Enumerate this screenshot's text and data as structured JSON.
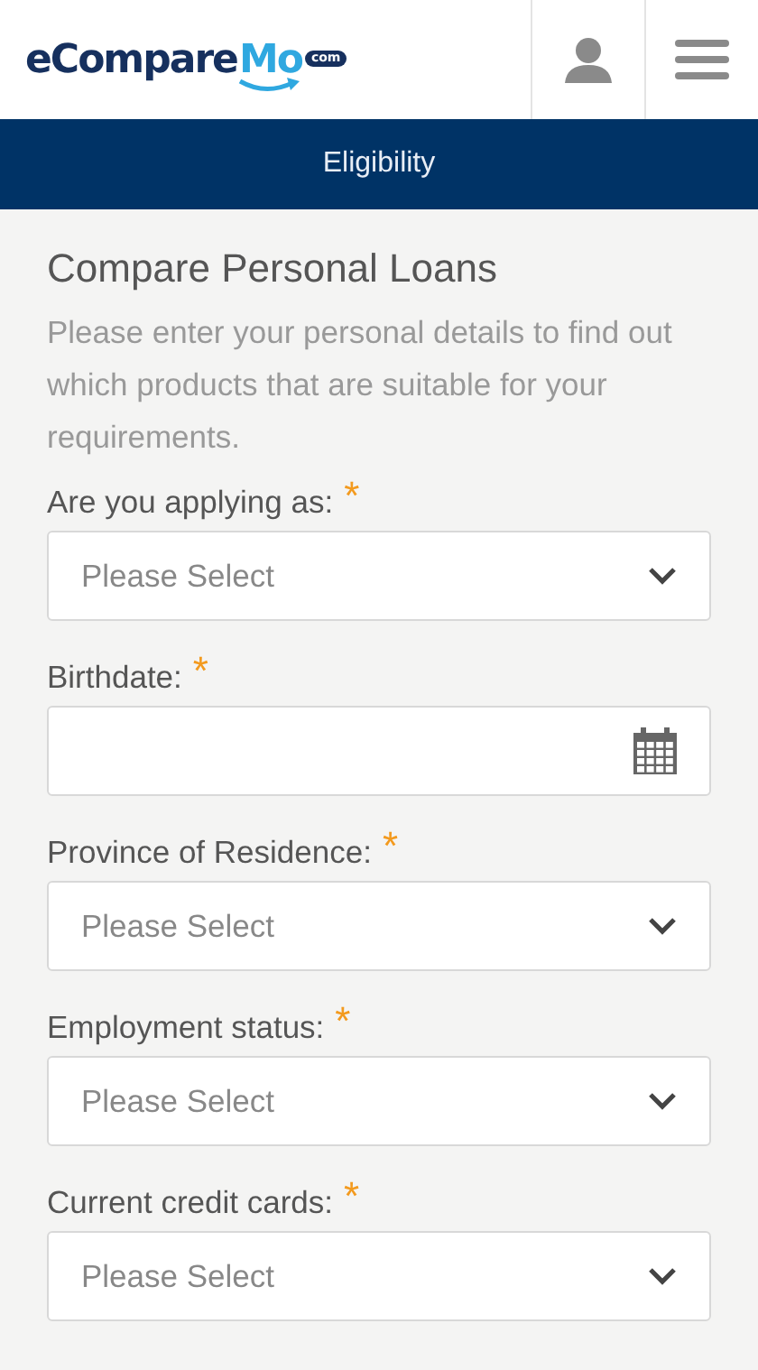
{
  "logo": {
    "main": "eCompare",
    "accent": "Mo",
    "badge": "com"
  },
  "nav_bar": {
    "title": "Eligibility"
  },
  "form": {
    "title": "Compare Personal Loans",
    "description": "Please enter your personal details to find out which products that are suitable for your requirements.",
    "fields": [
      {
        "kind": "select",
        "label": "Are you applying as:",
        "required_mark": "*",
        "placeholder": "Please Select"
      },
      {
        "kind": "date",
        "label": "Birthdate:",
        "required_mark": "*"
      },
      {
        "kind": "select",
        "label": "Province of Residence:",
        "required_mark": "*",
        "placeholder": "Please Select"
      },
      {
        "kind": "select",
        "label": "Employment status:",
        "required_mark": "*",
        "placeholder": "Please Select"
      },
      {
        "kind": "select",
        "label": "Current credit cards:",
        "required_mark": "*",
        "placeholder": "Please Select"
      }
    ]
  }
}
